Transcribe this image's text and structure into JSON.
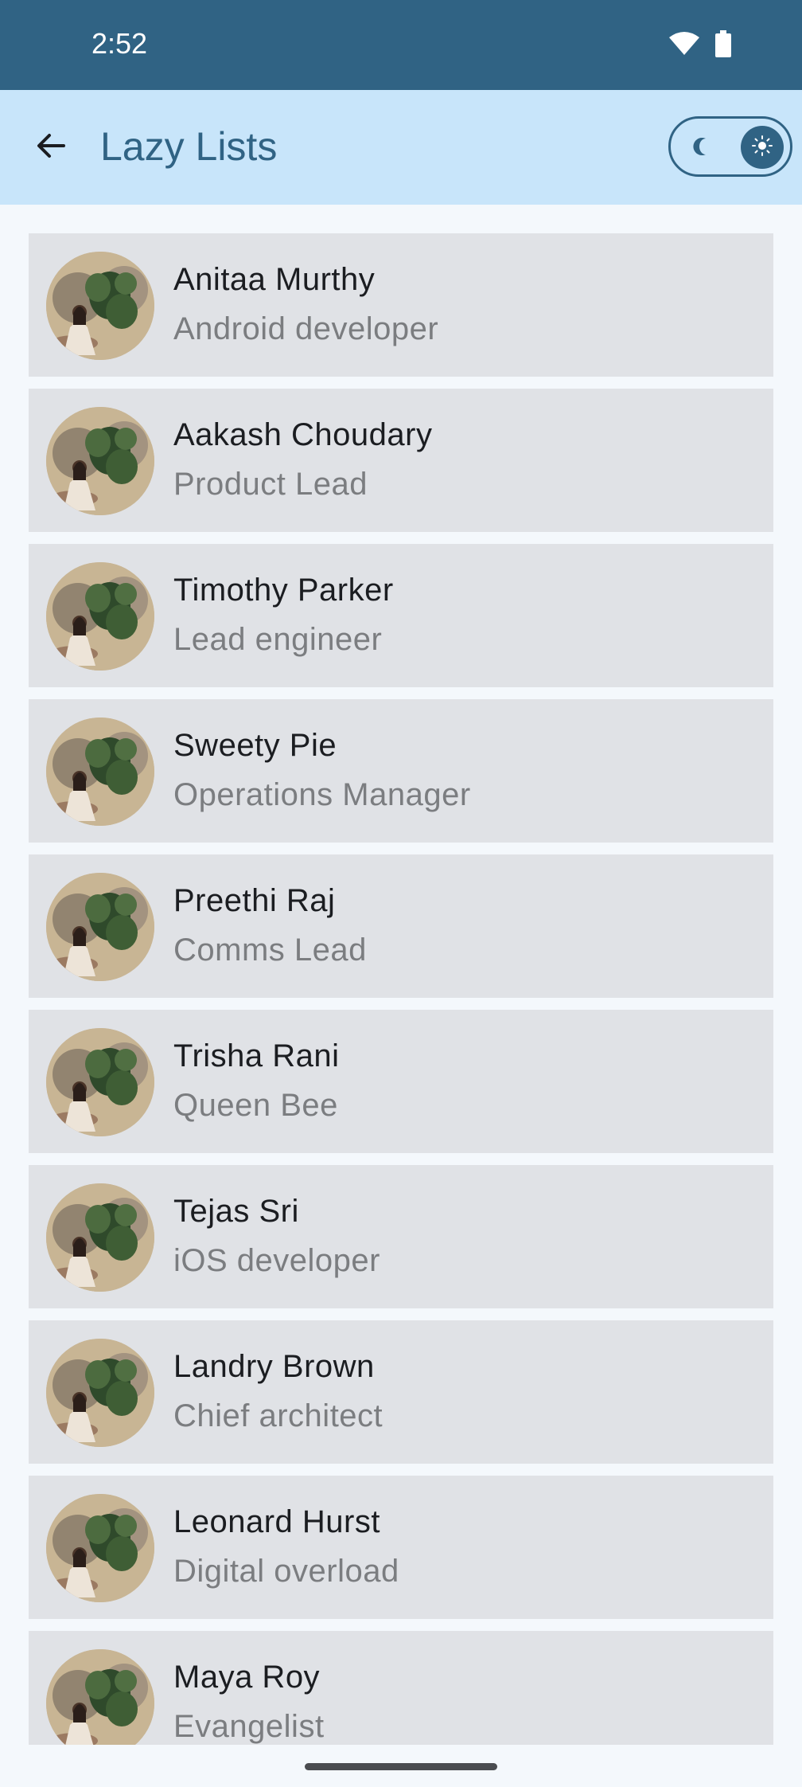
{
  "status_bar": {
    "time": "2:52",
    "icons": [
      "wifi-icon",
      "battery-icon"
    ]
  },
  "app_bar": {
    "title": "Lazy Lists",
    "back_icon": "arrow-back-icon",
    "toggle": {
      "left_icon": "moon-icon",
      "right_icon": "sun-icon",
      "selected": "light"
    }
  },
  "colors": {
    "status_bar": "#306384",
    "app_bar": "#c8e5fa",
    "accent": "#306384",
    "card": "#e0e2e6"
  },
  "people": [
    {
      "name": "Anitaa Murthy",
      "role": "Android developer"
    },
    {
      "name": "Aakash Choudary",
      "role": "Product Lead"
    },
    {
      "name": "Timothy Parker",
      "role": "Lead engineer"
    },
    {
      "name": "Sweety Pie",
      "role": "Operations Manager"
    },
    {
      "name": "Preethi Raj",
      "role": "Comms Lead"
    },
    {
      "name": "Trisha Rani",
      "role": "Queen Bee"
    },
    {
      "name": "Tejas Sri",
      "role": "iOS developer"
    },
    {
      "name": "Landry Brown",
      "role": "Chief architect"
    },
    {
      "name": "Leonard Hurst",
      "role": "Digital overload"
    },
    {
      "name": "Maya Roy",
      "role": "Evangelist"
    }
  ]
}
